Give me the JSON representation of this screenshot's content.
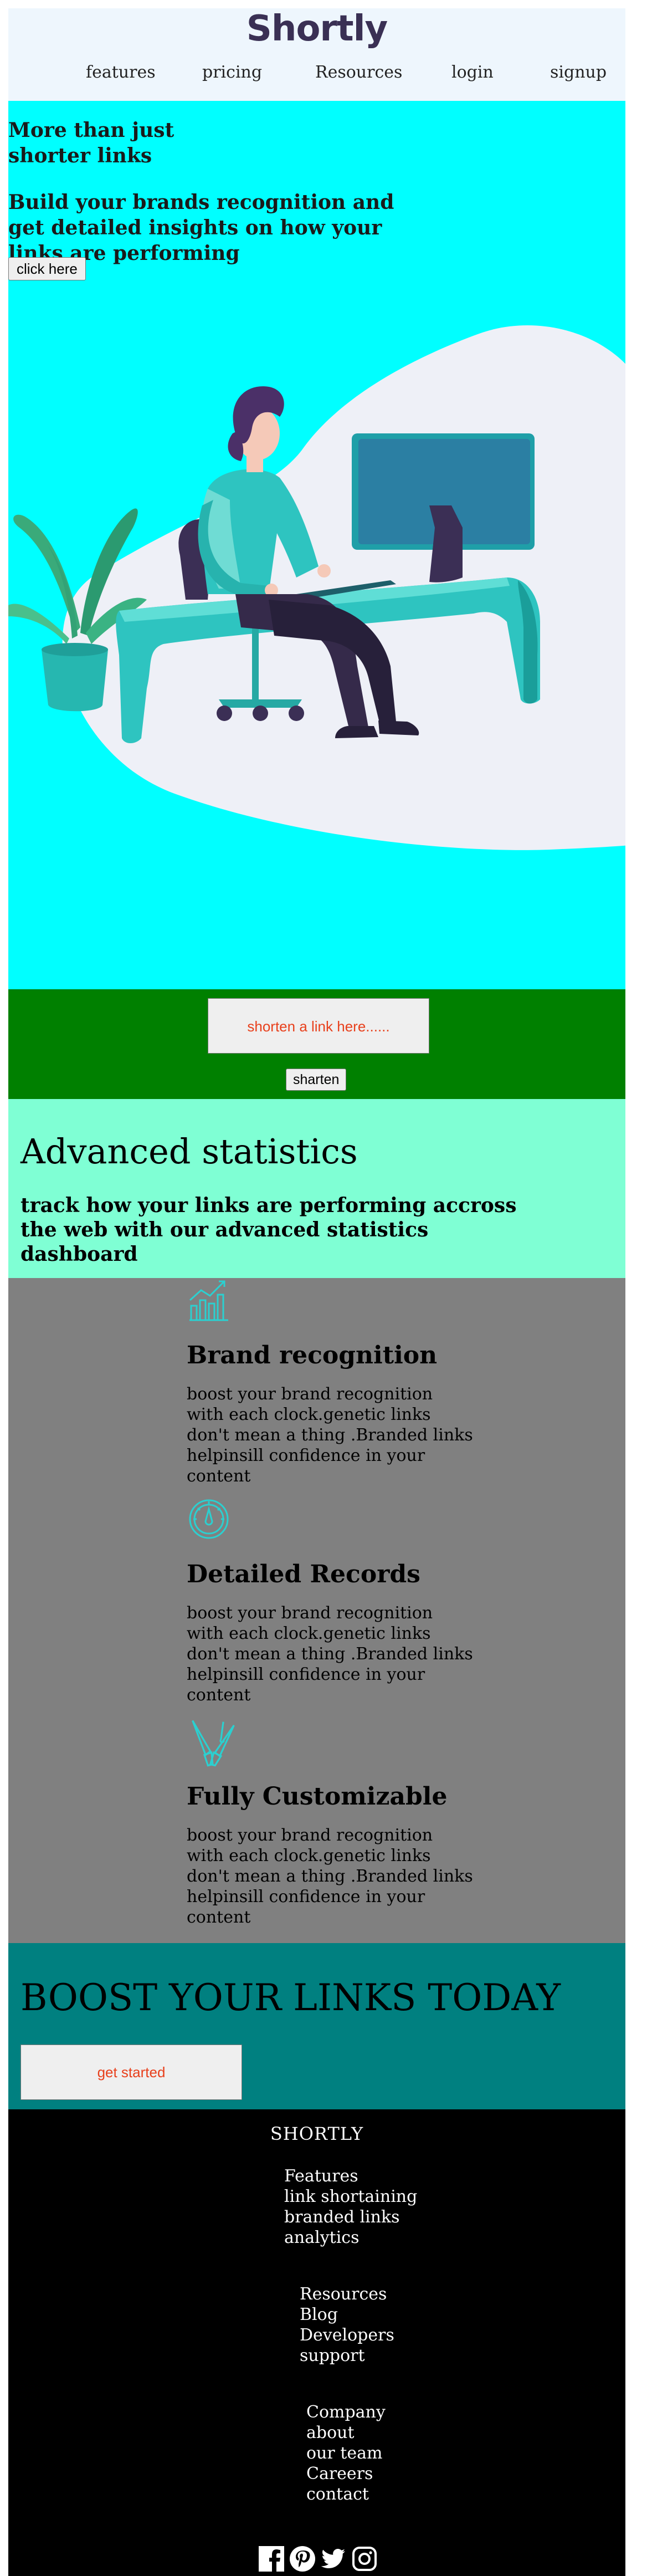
{
  "header": {
    "logo": "Shortly",
    "nav": [
      "features",
      "pricing",
      "Resources",
      "login",
      "signup"
    ]
  },
  "hero": {
    "title": "More than just shorter links",
    "subtitle": "Build your brands recognition and get detailed insights on how your links are performing",
    "button": "click here",
    "illustration": "person-working-at-desk-illustration"
  },
  "shorten": {
    "input_placeholder": "shorten a link here......",
    "button": "sharten"
  },
  "advanced": {
    "title": "Advanced statistics",
    "text": "track how your links are performing accross the web with our advanced statistics dashboard"
  },
  "features": [
    {
      "icon": "bar-chart-icon",
      "title": "Brand recognition",
      "text": "boost your brand recognition with each clock.genetic links don't mean a thing .Branded links helpinsill confidence in your content"
    },
    {
      "icon": "gauge-icon",
      "title": "Detailed Records",
      "text": "boost your brand recognition with each clock.genetic links don't mean a thing .Branded links helpinsill confidence in your content"
    },
    {
      "icon": "brushes-icon",
      "title": "Fully Customizable",
      "text": "boost your brand recognition with each clock.genetic links don't mean a thing .Branded links helpinsill confidence in your content"
    }
  ],
  "boost": {
    "title": "BOOST YOUR LINKS TODAY",
    "button": "get started"
  },
  "footer": {
    "brand": "SHORTLY",
    "columns": [
      [
        "Features",
        "link shortaining",
        "branded links",
        "analytics"
      ],
      [
        "Resources",
        "Blog",
        "Developers",
        "support"
      ],
      [
        "Company",
        "about",
        "our team",
        "Careers",
        "contact"
      ]
    ],
    "social": [
      "facebook-icon",
      "pinterest-icon",
      "twitter-icon",
      "instagram-icon"
    ]
  },
  "colors": {
    "header_bg": "#eef6fd",
    "hero_bg": "#00ffff",
    "shorten_bg": "#008000",
    "advanced_bg": "#7fffd4",
    "features_bg": "#808080",
    "boost_bg": "#008080",
    "footer_bg": "#000000",
    "button_text": "#e8401c"
  }
}
